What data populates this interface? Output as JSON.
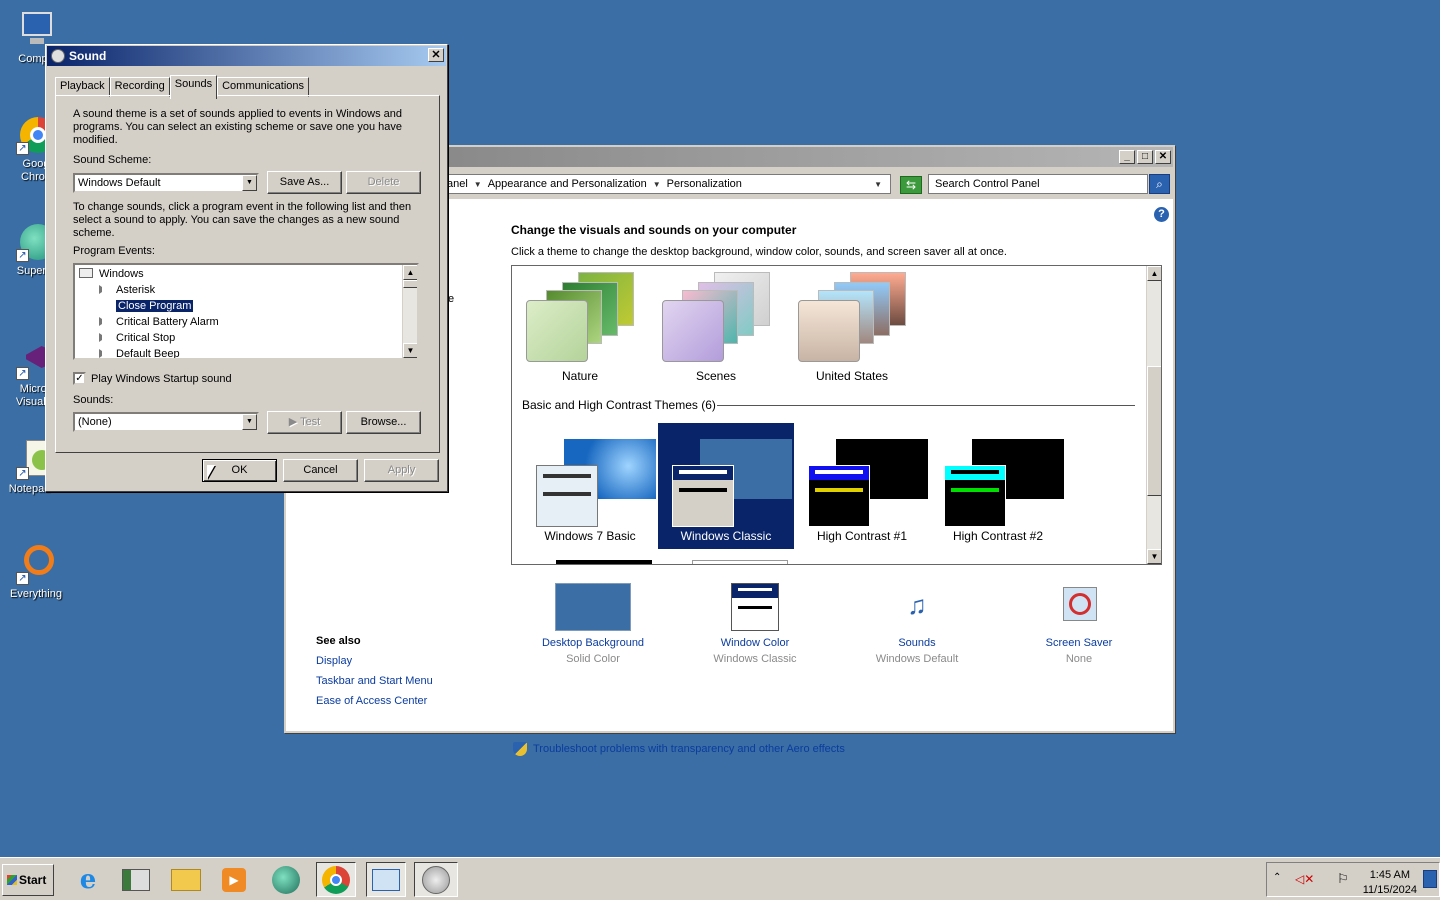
{
  "desktop": {
    "icons": [
      {
        "label": "Compu",
        "icon": "computer-icon"
      },
      {
        "label": "Goog\nChron",
        "icon": "chrome-icon"
      },
      {
        "label": "Superm",
        "icon": "supermium-icon"
      },
      {
        "label": "Micros\nVisual S",
        "icon": "visual-studio-icon"
      },
      {
        "label": "Notepad++",
        "icon": "notepad-plus-plus-icon"
      },
      {
        "label": "Everything",
        "icon": "everything-search-icon"
      }
    ]
  },
  "control_panel": {
    "breadcrumb": [
      "anel",
      "Appearance and Personalization",
      "Personalization"
    ],
    "search_placeholder": "Search Control Panel",
    "heading": "Change the visuals and sounds on your computer",
    "subheading": "Click a theme to change the desktop background, window color, sounds, and screen saver all at once.",
    "aero_themes": [
      {
        "label": "Nature"
      },
      {
        "label": "Scenes"
      },
      {
        "label": "United States"
      }
    ],
    "basic_group_title": "Basic and High Contrast Themes (6)",
    "basic_themes": [
      {
        "label": "Windows 7 Basic",
        "selected": false
      },
      {
        "label": "Windows Classic",
        "selected": true
      },
      {
        "label": "High Contrast #1",
        "selected": false
      },
      {
        "label": "High Contrast #2",
        "selected": false
      }
    ],
    "bottom_items": [
      {
        "label": "Desktop Background",
        "value": "Solid Color",
        "icon": "desktop-background-icon"
      },
      {
        "label": "Window Color",
        "value": "Windows Classic",
        "icon": "window-color-icon"
      },
      {
        "label": "Sounds",
        "value": "Windows Default",
        "icon": "sounds-icon"
      },
      {
        "label": "Screen Saver",
        "value": "None",
        "icon": "screen-saver-icon"
      }
    ],
    "see_also": {
      "title": "See also",
      "links": [
        "Display",
        "Taskbar and Start Menu",
        "Ease of Access Center"
      ]
    },
    "troubleshoot_link": "Troubleshoot problems with transparency and other Aero effects",
    "left_fragment": "e"
  },
  "sound_dialog": {
    "title": "Sound",
    "tabs": [
      "Playback",
      "Recording",
      "Sounds",
      "Communications"
    ],
    "active_tab": "Sounds",
    "intro": "A sound theme is a set of sounds applied to events in Windows and programs.  You can select an existing scheme or save one you have modified.",
    "scheme_label": "Sound Scheme:",
    "scheme_value": "Windows Default",
    "save_as": "Save As...",
    "delete": "Delete",
    "instructions": "To change sounds, click a program event in the following list and then select a sound to apply.  You can save the changes as a new sound scheme.",
    "events_label": "Program Events:",
    "events_root": "Windows",
    "events": [
      "Asterisk",
      "Close Program",
      "Critical Battery Alarm",
      "Critical Stop",
      "Default Beep"
    ],
    "selected_event": "Close Program",
    "startup_checkbox": "Play Windows Startup sound",
    "startup_checked": true,
    "sounds_label": "Sounds:",
    "sounds_value": "(None)",
    "test": "Test",
    "browse": "Browse...",
    "ok": "OK",
    "cancel": "Cancel",
    "apply": "Apply"
  },
  "taskbar": {
    "start_label": "Start",
    "pinned": [
      "internet-explorer-icon",
      "server-manager-icon",
      "file-explorer-icon",
      "media-player-icon",
      "supermium-icon",
      "chrome-icon",
      "control-panel-icon",
      "sound-icon"
    ],
    "clock_time": "1:45 AM",
    "clock_date": "11/15/2024"
  }
}
